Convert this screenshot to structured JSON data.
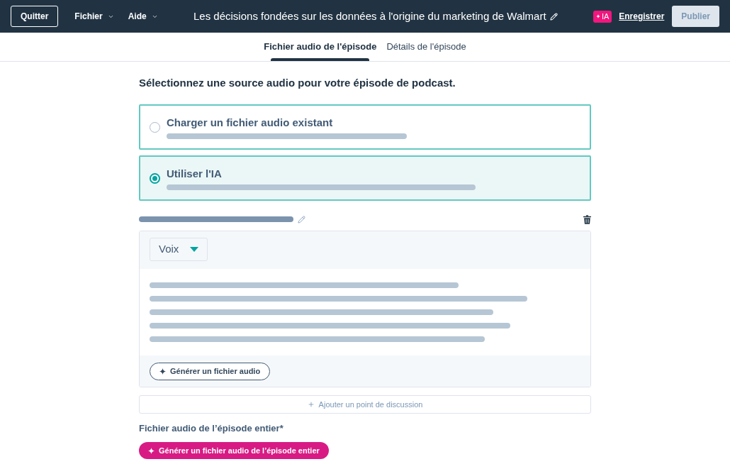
{
  "header": {
    "quit_button": "Quitter",
    "menus": [
      {
        "label": "Fichier"
      },
      {
        "label": "Aide"
      }
    ],
    "title": "Les décisions fondées sur les données à l'origine du marketing de Walmart",
    "ai_button": "IA",
    "save_link": "Enregistrer",
    "publish_button": {
      "label": "Publier",
      "disabled": true
    }
  },
  "tabs": [
    {
      "label": "Fichier audio de l'épisode",
      "selected": true
    },
    {
      "label": "Détails de l'épisode",
      "selected": false
    }
  ],
  "heading": "Sélectionnez une source audio pour votre épisode de podcast.",
  "sources": [
    {
      "label": "Charger un fichier audio existant",
      "selected": false
    },
    {
      "label": "Utiliser l'IA",
      "selected": true
    }
  ],
  "talking_point": {
    "voice_dropdown": "Voix",
    "generate_button": "Générer un fichier audio"
  },
  "add_button": "Ajouter un point de discussion",
  "full_episode": {
    "label": "Fichier audio de l’épisode entier*",
    "generate_button": "Générer un fichier audio de l’épisode entier"
  }
}
